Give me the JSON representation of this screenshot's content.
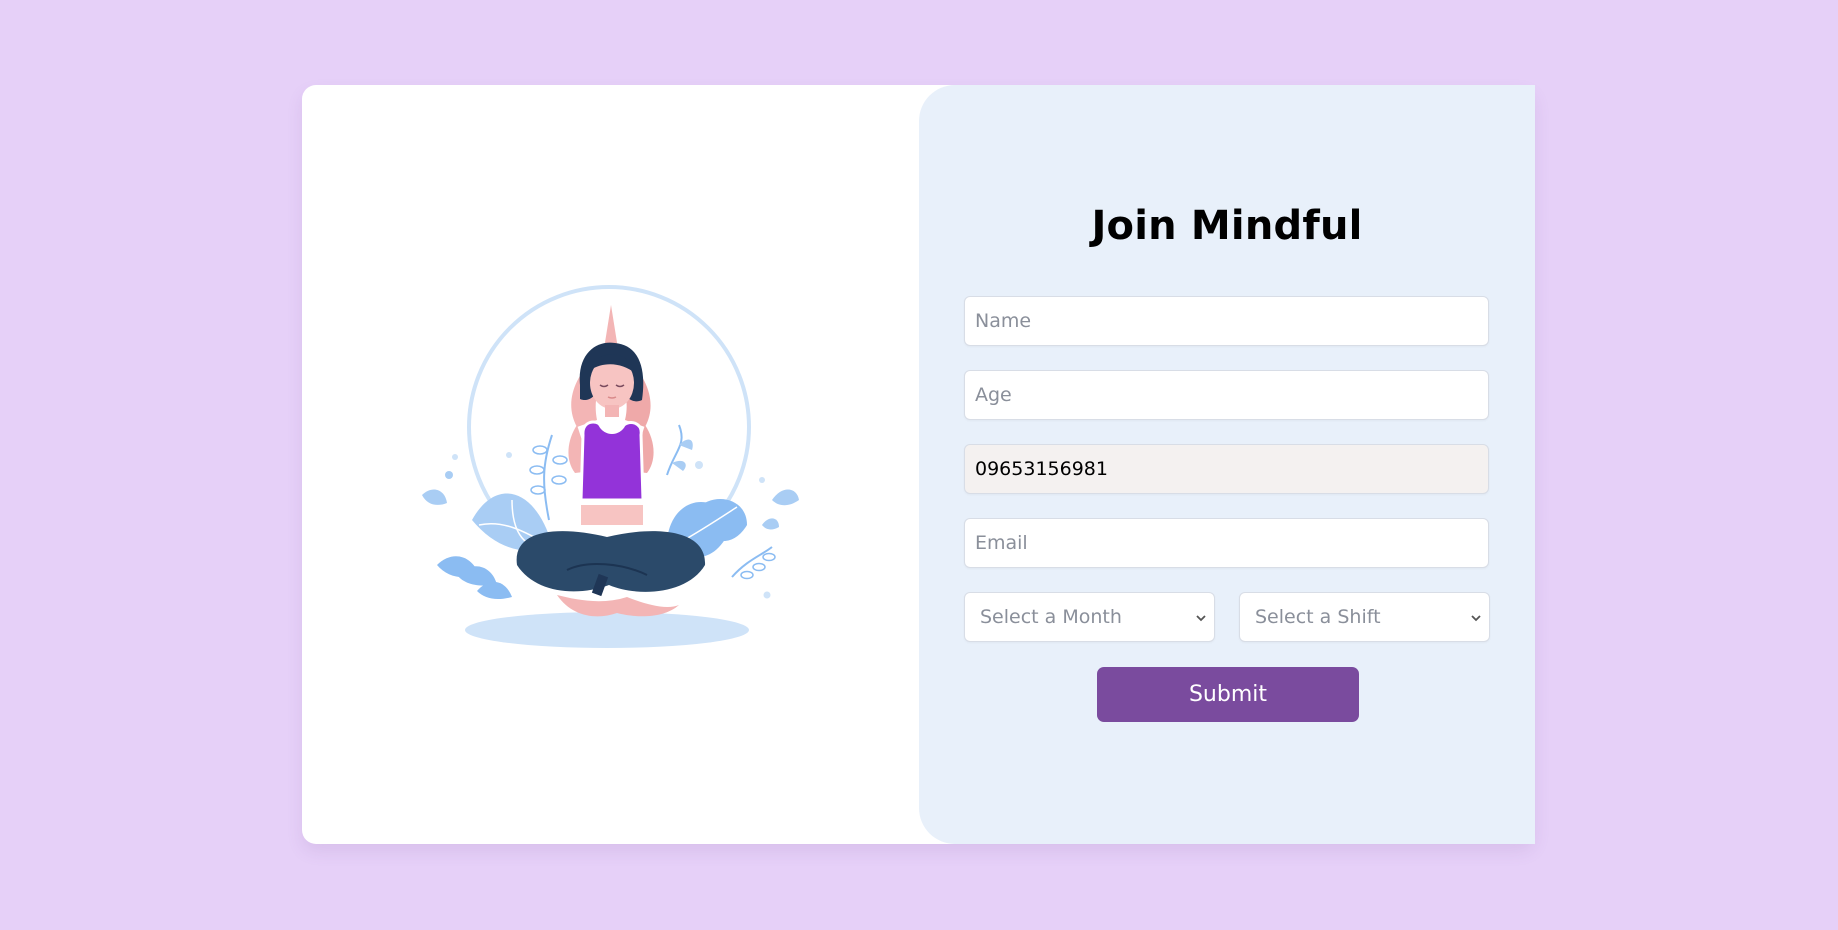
{
  "form": {
    "title": "Join Mindful",
    "name_placeholder": "Name",
    "age_placeholder": "Age",
    "phone_value": "09653156981",
    "email_placeholder": "Email",
    "month_select_label": "Select a Month",
    "shift_select_label": "Select a Shift",
    "submit_label": "Submit"
  },
  "illustration": {
    "subject": "woman-meditating-yoga-pose"
  },
  "colors": {
    "page_background": "#e6d0f8",
    "card_background": "#ffffff",
    "form_panel_background": "#e8f0fa",
    "submit_background": "#7a4b9e",
    "top_color": "#9333d9",
    "leaf_color": "#8bbcf2"
  },
  "icons": {
    "select_chevron": "chevron-down-icon"
  }
}
